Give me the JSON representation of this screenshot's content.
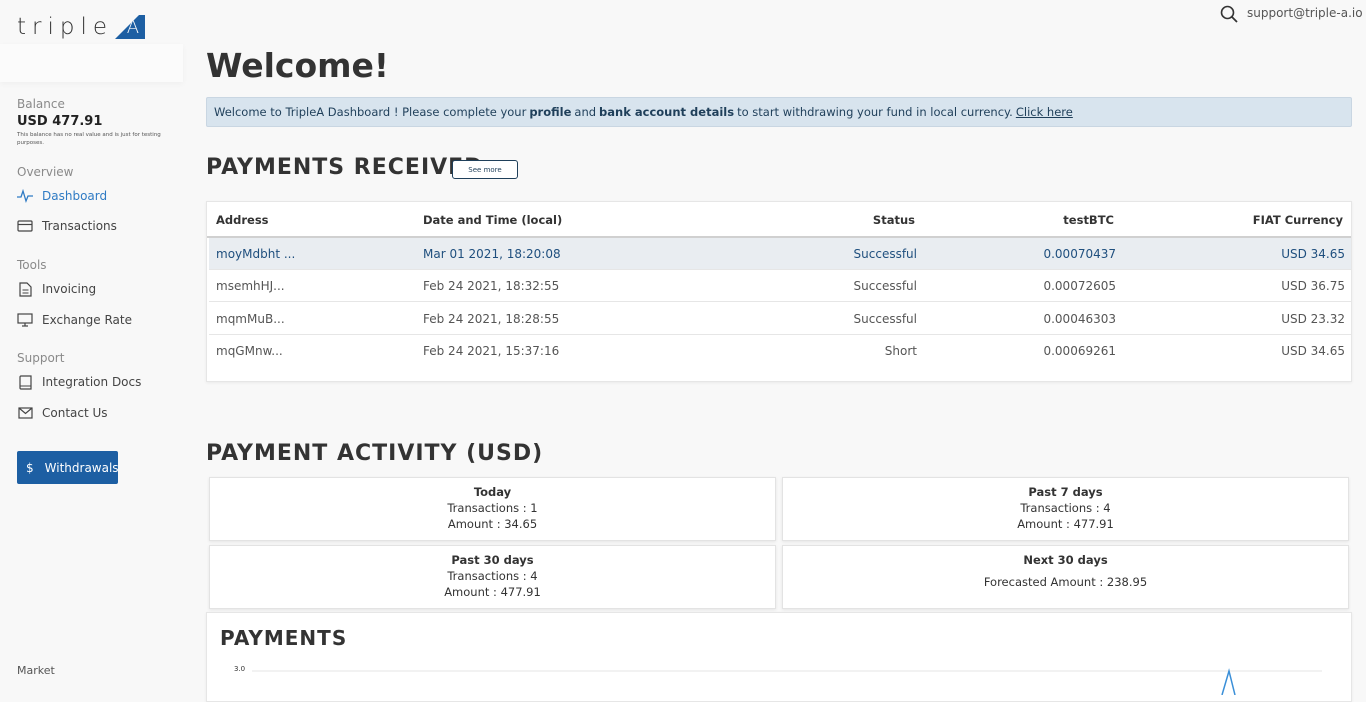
{
  "header": {
    "support_email": "support@triple-a.io",
    "search_icon": "search-icon"
  },
  "logo": {
    "text": "triple",
    "mark": "A"
  },
  "sidebar": {
    "balance_label": "Balance",
    "balance_value": "USD 477.91",
    "balance_note": "This balance has no real value and is just for testing purposes.",
    "overview_label": "Overview",
    "tools_label": "Tools",
    "support_label": "Support",
    "items": [
      {
        "label": "Dashboard",
        "icon": "activity-icon"
      },
      {
        "label": "Transactions",
        "icon": "card-icon"
      },
      {
        "label": "Invoicing",
        "icon": "file-icon"
      },
      {
        "label": "Exchange Rate",
        "icon": "monitor-icon"
      },
      {
        "label": "Integration Docs",
        "icon": "book-icon"
      },
      {
        "label": "Contact Us",
        "icon": "mail-icon"
      }
    ],
    "withdraw_label": "Withdrawals",
    "market_label": "Market"
  },
  "main": {
    "welcome_title": "Welcome!",
    "banner": {
      "part1": "Welcome to TripleA Dashboard ! Please complete your",
      "bold1": "profile",
      "part2": "and",
      "bold2": "bank account details",
      "part3": "to start withdrawing your fund in local currency.",
      "link": "Click here"
    },
    "payments_received_title": "PAYMENTS RECEIVED",
    "see_more": "See more",
    "table": {
      "headers": [
        "Address",
        "Date and Time (local)",
        "Status",
        "testBTC",
        "FIAT Currency"
      ],
      "rows": [
        {
          "address": "moyMdbht ...",
          "date": "Mar 01 2021, 18:20:08",
          "status": "Successful",
          "btc": "0.00070437",
          "fiat": "USD 34.65"
        },
        {
          "address": "msemhHJ...",
          "date": "Feb 24 2021, 18:32:55",
          "status": "Successful",
          "btc": "0.00072605",
          "fiat": "USD 36.75"
        },
        {
          "address": "mqmMuB...",
          "date": "Feb 24 2021, 18:28:55",
          "status": "Successful",
          "btc": "0.00046303",
          "fiat": "USD 23.32"
        },
        {
          "address": "mqGMnw...",
          "date": "Feb 24 2021, 15:37:16",
          "status": "Short",
          "btc": "0.00069261",
          "fiat": "USD 34.65"
        }
      ]
    },
    "activity_title": "PAYMENT ACTIVITY (USD)",
    "activity": {
      "today": {
        "title": "Today",
        "line1": "Transactions : 1",
        "line2": "Amount : 34.65"
      },
      "past7": {
        "title": "Past 7 days",
        "line1": "Transactions : 4",
        "line2": "Amount : 477.91"
      },
      "past30": {
        "title": "Past 30 days",
        "line1": "Transactions : 4",
        "line2": "Amount : 477.91"
      },
      "next30": {
        "title": "Next 30 days",
        "line1": "Forecasted Amount : 238.95"
      }
    },
    "payments_title": "PAYMENTS",
    "chart_y_tick": "3.0"
  },
  "colors": {
    "accent": "#1d5fa3",
    "link_active": "#2f7bc4",
    "banner_bg": "#d8e4ee"
  }
}
